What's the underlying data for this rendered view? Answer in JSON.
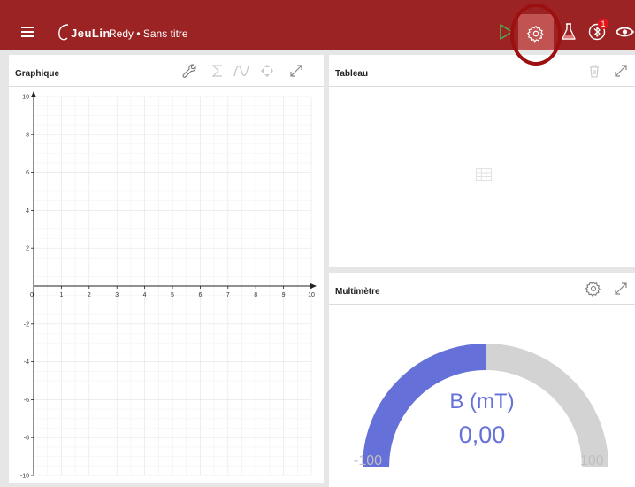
{
  "topbar": {
    "brand": "JeuLin",
    "title": "Redy • Sans titre",
    "bluetooth_badge": "1",
    "icons": [
      "menu-icon",
      "play-icon",
      "gear-icon",
      "flask-icon",
      "bluetooth-icon",
      "eye-icon"
    ]
  },
  "graph_panel": {
    "title": "Graphique",
    "icons": [
      "wrench-icon",
      "sigma-icon",
      "curve-fit-icon",
      "move-icon",
      "expand-icon"
    ]
  },
  "chart_data": {
    "type": "line",
    "series": [],
    "xlim": [
      0,
      10
    ],
    "ylim": [
      -10,
      10
    ],
    "x_ticks": [
      "0",
      "1",
      "2",
      "3",
      "4",
      "5",
      "6",
      "7",
      "8",
      "9",
      "10"
    ],
    "y_ticks": [
      "10",
      "8",
      "6",
      "4",
      "2",
      "-2",
      "-4",
      "-6",
      "-8",
      "-10"
    ],
    "grid": true
  },
  "table_panel": {
    "title": "Tableau",
    "icons": [
      "trash-icon",
      "expand-icon",
      "table-icon"
    ]
  },
  "multimeter_panel": {
    "title": "Multimètre",
    "icons": [
      "gear-icon",
      "expand-icon"
    ],
    "quantity": "B (mT)",
    "value": "0,00",
    "min": "-100",
    "max": "100",
    "fill_fraction": 0.5,
    "gauge_color": "#6670d9",
    "track_color": "#d3d3d3"
  },
  "colors": {
    "header": "#9c2323",
    "highlight": "#9c1010",
    "play": "#4caf50"
  }
}
